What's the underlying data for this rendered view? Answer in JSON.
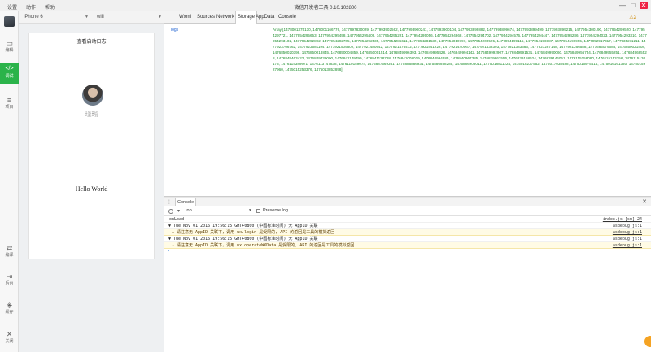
{
  "menu": [
    "设置",
    "动作",
    "帮助"
  ],
  "window_title": "微信开发者工具 0.10.102800",
  "window_controls": [
    "—",
    "□",
    "✕"
  ],
  "sidebar": [
    {
      "icon": "edit-icon",
      "glyph": "▭",
      "label": "编辑"
    },
    {
      "icon": "code-icon",
      "glyph": "</>",
      "label": "调试"
    },
    {
      "icon": "project-icon",
      "glyph": "≡",
      "label": "项目"
    },
    {
      "icon": "compile-icon",
      "glyph": "⇄",
      "label": "编译"
    },
    {
      "icon": "background-icon",
      "glyph": "⇥",
      "label": "后台"
    },
    {
      "icon": "cache-icon",
      "glyph": "◈",
      "label": "缓存"
    },
    {
      "icon": "close-icon",
      "glyph": "✕",
      "label": "关闭"
    }
  ],
  "simulator": {
    "device": "iPhone 6",
    "network": "wifi",
    "page_title": "查看启动日志",
    "user_name": "瑾瑜",
    "hello_text": "Hello World"
  },
  "devtools": {
    "tabs": [
      "Wxml",
      "Sources",
      "Network",
      "Storage",
      "AppData",
      "Console"
    ],
    "active_tab": "Storage",
    "warning_count": "⚠2",
    "storage": {
      "key": "logs",
      "value": "Array [1478001375130, 1478001166776, 1477997830029, 1477993902562, 1477993900241, 1477993900104, 1477993899882, 1477993899674, 1477993899499, 1477993899215, 1477954300190, 1477954299520, 1477954297721, 1477954295653, 1477954295498, 1477954295409, 1477954295221, 1477954295056, 1477954294868, 1477954294702, 1477954294576, 1477954294447, 1477954294286, 1477954294023, 1477954293310, 1477954293102, 1477954292892, 1477954292705, 1477954292535, 1477954285611, 1477954281532, 1477954010797, 1477954200595, 1477954199115, 1477954196987, 1477954196955, 1477952917317, 1477935211211, 1477923706762, 1477923581194, 1477921509602, 1477921480942, 1477921476472, 1477921441222, 1477921440067, 1477921438393, 1477921383386, 1477921287148, 1477921266588, 1477685079688, 1476850021408, 1476850020398, 1476850018845, 1476850004859, 1476850001514, 1476849996393, 1476849995428, 1476849994142, 1476849992907, 1476849991531, 1476849990060, 1476849956754, 1476849955251, 1476849685528, 1476849463422, 1476849439090, 1476841149799, 1476841138788, 1476841008019, 1476840994285, 1476840967385, 1476839867556, 1476839158524, 1476839146051, 1476115158080, 1476115153356, 1476115130173, 1476114389971, 1476113747838, 1476110159074, 1475887569361, 1475886886931, 1475886938285, 1475886908011, 1475018811224, 1475018237552, 1475017038488, 1475016975414, 1475016161330, 1475015927960, 1475015253376, 1475013852898]"
    }
  },
  "console": {
    "tab_label": "Console",
    "context": "top",
    "preserve_log": "Preserve log",
    "rows": [
      {
        "kind": "plain",
        "text": "onLoad",
        "source": "index.js [sm]:24"
      },
      {
        "kind": "group",
        "text": "▼ Tue Nov 01 2016 19:56:15 GMT+0800 (中国标准时间) 无 AppID 关联",
        "source": "asdebug.js:1"
      },
      {
        "kind": "warn",
        "text": "⚠ 请注意无 AppID 关联下，调用 wx.login 是受限的, API 的返回是工具的模拟返回",
        "source": "asdebug.js:1"
      },
      {
        "kind": "group",
        "text": "▼ Tue Nov 01 2016 19:56:15 GMT+0800 (中国标准时间) 无 AppID 关联",
        "source": "asdebug.js:1"
      },
      {
        "kind": "warn",
        "text": "⚠ 请注意无 AppID 关联下，调用 wx.operateWXData 是受限的, API 的返回是工具的模拟返回",
        "source": "asdebug.js:1"
      }
    ],
    "prompt": "›"
  }
}
